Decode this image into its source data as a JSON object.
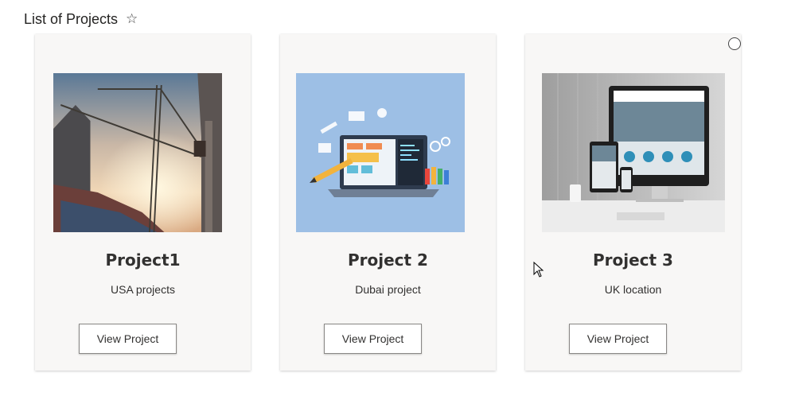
{
  "page": {
    "title": "List of Projects",
    "favorite_icon": "star-outline-icon"
  },
  "projects": [
    {
      "title": "Project1",
      "description": "USA projects",
      "button_label": "View Project",
      "image": "construction-crane-photo"
    },
    {
      "title": "Project 2",
      "description": "Dubai project",
      "button_label": "View Project",
      "image": "web-development-illustration"
    },
    {
      "title": "Project 3",
      "description": "UK location",
      "button_label": "View Project",
      "image": "responsive-webdesign-devices-photo"
    }
  ]
}
